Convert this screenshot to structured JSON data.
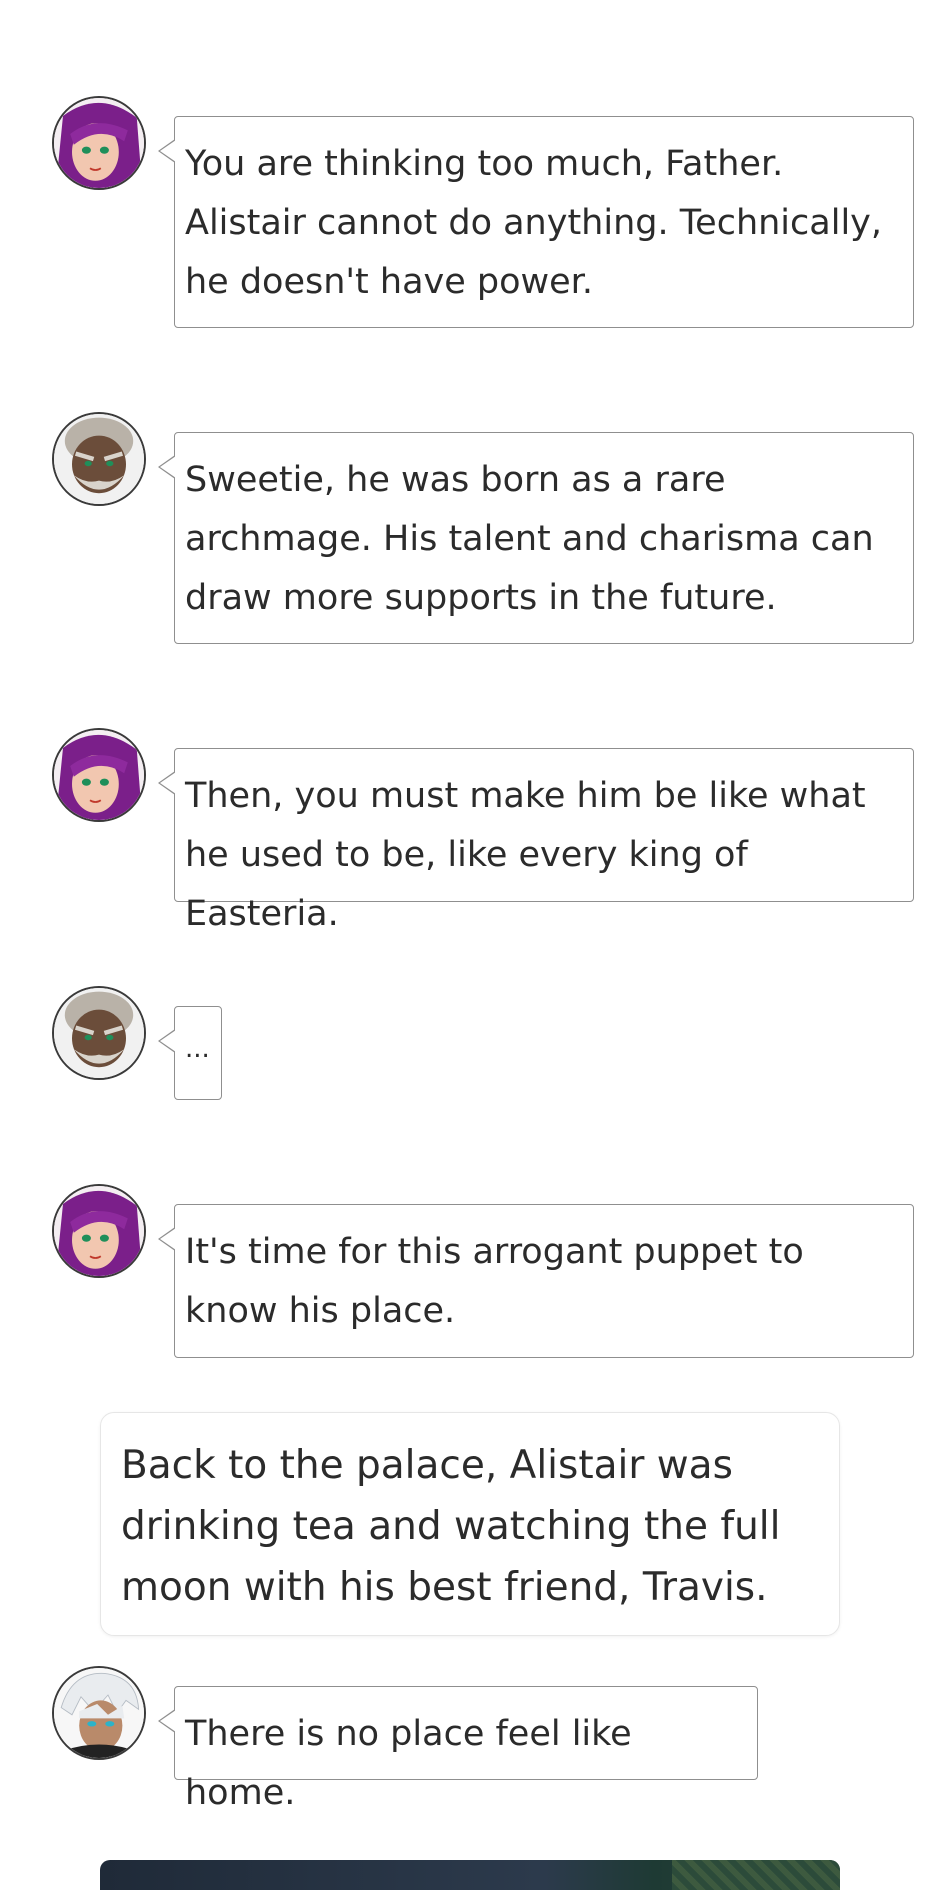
{
  "messages": [
    {
      "speaker_avatar": "purple-haired-woman-avatar",
      "text": "You are thinking too much, Father. Alistair cannot do anything. Technically, he doesn't have power."
    },
    {
      "speaker_avatar": "old-bearded-man-avatar",
      "text": "Sweetie, he was born as a rare archmage. His talent and charisma can draw more supports in the future."
    },
    {
      "speaker_avatar": "purple-haired-woman-avatar",
      "text": "Then, you must make him be like what he used to be, like every king of Easteria."
    },
    {
      "speaker_avatar": "old-bearded-man-avatar",
      "text": "..."
    },
    {
      "speaker_avatar": "purple-haired-woman-avatar",
      "text": "It's time for this arrogant puppet to know his place."
    }
  ],
  "narration": "Back to the palace, Alistair was drinking tea and watching the full moon with his best friend, Travis.",
  "final_message": {
    "speaker_avatar": "white-haired-man-avatar",
    "text": "There is no place feel like home."
  },
  "colors": {
    "bubble_border": "#8f8f8f",
    "purple_hair": "#7b1f8a",
    "old_man_skin": "#6b4d3a",
    "white_hair": "#e9ecef"
  }
}
